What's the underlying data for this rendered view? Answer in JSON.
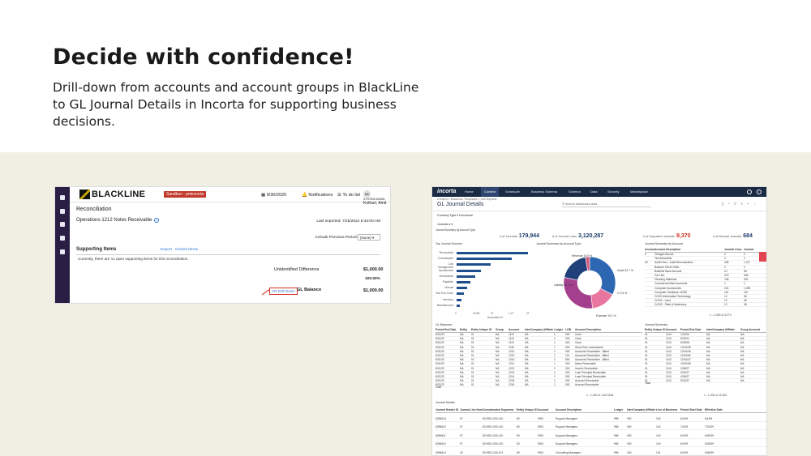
{
  "hero": {
    "title": "Decide with confidence!",
    "body": "Drill-down from accounts and account groups in BlackLine to GL Journal Details in Incorta for supporting business decisions."
  },
  "blackline": {
    "logo": "BLACKLINE",
    "sandbox": "Sandbox - pmincorta",
    "date": "9/30/2020",
    "notifications": "Notifications",
    "todo": "To do list",
    "avatar": "AK",
    "user_role": "SYSTEM ADMIN",
    "user_name": "Kothari, Amit",
    "page_title": "Reconciliation",
    "account": "Operations-1212 Notes Receivable",
    "last_imported": "Last imported: 7/25/2022 8:43:00 AM",
    "include_prev_label": "Include Previous Period:",
    "include_prev_value": "(None)",
    "supporting_items": "Supporting Items",
    "export": "Export",
    "closed_items": "Closed Items",
    "no_items": "Currently, there are no open supporting items for this reconciliation.",
    "unidentified_label": "Unidentified Difference",
    "unidentified_value": "$1,000.00",
    "percent_value": "100.00%",
    "drill_link": "AR Drill Down",
    "gl_label": "GL Balance",
    "gl_value": "$1,000.00",
    "accent": "#2a1e45"
  },
  "incorta": {
    "logo": "incorta",
    "nav": [
      "Home",
      "Content",
      "Scheduler",
      "Business Schema",
      "Schema",
      "Data",
      "Security",
      "Marketplace"
    ],
    "breadcrumb": "Content  >  BlackLine Templates  >  Drill Reports",
    "title": "GL Journal Details",
    "search_placeholder": "Search dashboard data",
    "currency_type": "Currency Type  ▾  Functional",
    "journals_label": "Journals  ▾  4",
    "kpis": [
      {
        "label": "# of Journals",
        "value": "179,944"
      },
      {
        "label": "# of Journal Lines",
        "value": "3,120,287"
      },
      {
        "label": "# of Unposted Journals",
        "value": "8,370"
      },
      {
        "label": "# of Manual Journals",
        "value": "684"
      }
    ],
    "sections": {
      "sources": "Top Journal Sources",
      "summary_type": "Journal Summary by Account Type",
      "summary_account": "Journal Summary by Account",
      "gl_balances": "GL Balances",
      "journal_summary": "Journal Summary",
      "journal_details": "Journal Details",
      "journal_summary_type_bar": "Journal Summary by Account Type",
      "x_axis": "Accounted Cr"
    },
    "chart_data": [
      {
        "type": "bar",
        "title": "Top Journal Sources",
        "categories": [
          "Receivables",
          "Consolidation",
          "Cost Management",
          "Spreadsheet",
          "Receivables",
          "Payables",
          "Manual",
          "Year End Close",
          "Inventory",
          "Miscellaneous"
        ],
        "values": [
          10.6,
          8.2,
          5.1,
          3.6,
          2.8,
          2.1,
          1.6,
          1.1,
          0.7,
          0.5
        ],
        "xlabel": "Accounted Cr",
        "x_ticks": [
          "0",
          "10.0B",
          "1T",
          "1.2T",
          "2T"
        ]
      },
      {
        "type": "pie",
        "title": "Journal Summary by Account Type",
        "labels": [
          "Asset 32.7 %",
          "Revenue 15.5 %",
          "Liability 30.1 %",
          "Expense 19.1 %",
          "O 2.6 %"
        ],
        "values": [
          32.7,
          15.5,
          30.1,
          19.1,
          2.6
        ],
        "colors": [
          "#2e67b1",
          "#e8769e",
          "#a43f8e",
          "#1f4079",
          "#d65a7d"
        ]
      }
    ],
    "account_table": {
      "headers": [
        "Account",
        "Account Description",
        "Journal Lines",
        "Journal"
      ],
      "rows": [
        [
          "0",
          "Charges Accrue",
          "2",
          "2"
        ],
        [
          "",
          "Tint deductible",
          "2",
          "2"
        ],
        [
          "00",
          "Audit Fees - Audit Remuneration",
          "296",
          "1,017"
        ],
        [
          "",
          "Balance Sheet Other",
          "2",
          "2"
        ],
        [
          "",
          "Backlink Bank Account",
          "12",
          "36"
        ],
        [
          "",
          "Car Hire",
          "379",
          "936"
        ],
        [
          "",
          "Cleaning Materials",
          "108",
          "324"
        ],
        [
          "",
          "Commercial Bank Accounts",
          "1",
          "1"
        ],
        [
          "",
          "Computer Accessories",
          "224",
          "1,005"
        ],
        [
          "",
          "Computer Hardware <£250",
          "110",
          "110"
        ],
        [
          "",
          "COGS Information Technology",
          "12",
          "36"
        ],
        [
          "",
          "COGS - Land",
          "12",
          "36"
        ],
        [
          "",
          "COGS - Plant & Machinery",
          "12",
          "36"
        ]
      ],
      "pager": "1 - 1,000 of 3,274"
    },
    "gl_table": {
      "headers": [
        "Period End Date",
        "Entity",
        "Entity Unique ID",
        "Group",
        "Account",
        "InterCompany Affiliate",
        "Ledger",
        "LOB",
        "Account Description"
      ],
      "rows": [
        [
          "8/31/22",
          "NA",
          "01",
          "NA",
          "1110",
          "NA",
          "1",
          "000",
          "Cash"
        ],
        [
          "8/31/22",
          "NA",
          "01",
          "NA",
          "1110",
          "NA",
          "1",
          "000",
          "Cash"
        ],
        [
          "8/31/22",
          "NA",
          "01",
          "NA",
          "1110",
          "NA",
          "1",
          "420",
          "Cash"
        ],
        [
          "8/31/22",
          "NA",
          "01",
          "NA",
          "1130",
          "NA",
          "1",
          "000",
          "Short Term Investments"
        ],
        [
          "8/31/22",
          "NA",
          "01",
          "NA",
          "1210",
          "NA",
          "1",
          "000",
          "Accounts Receivable - Billed"
        ],
        [
          "8/31/22",
          "NA",
          "01",
          "NA",
          "1210",
          "NA",
          "1",
          "110",
          "Accounts Receivable - Billed"
        ],
        [
          "8/31/22",
          "NA",
          "01",
          "NA",
          "1210",
          "NA",
          "1",
          "500",
          "Accounts Receivable - Billed"
        ],
        [
          "8/31/22",
          "NA",
          "01",
          "NA",
          "1211",
          "NA",
          "1",
          "000",
          "Notes Receivable"
        ],
        [
          "8/31/22",
          "NA",
          "01",
          "NA",
          "1212",
          "NA",
          "1",
          "000",
          "Invoice Receivable"
        ],
        [
          "8/31/22",
          "NA",
          "01",
          "NA",
          "1213",
          "NA",
          "1",
          "000",
          "Loan Principal Receivable"
        ],
        [
          "8/31/22",
          "NA",
          "01",
          "NA",
          "1214",
          "NA",
          "1",
          "000",
          "Loan Principal Receivable"
        ],
        [
          "8/31/22",
          "NA",
          "01",
          "NA",
          "1215",
          "NA",
          "1",
          "000",
          "Accrued Receivable"
        ],
        [
          "8/31/22",
          "NA",
          "01",
          "NA",
          "1216",
          "NA",
          "1",
          "000",
          "Accrued Receivable"
        ]
      ],
      "total": "Total",
      "pager": "1 - 1,000 of 1,647,818"
    },
    "summary_table": {
      "headers": [
        "Entity Unique ID",
        "Account",
        "Period End Date",
        "InterCompany Affiliate",
        "Group Account"
      ],
      "rows": [
        [
          "01",
          "1110",
          "1/31/04",
          "NA",
          "NA"
        ],
        [
          "01",
          "1110",
          "6/30/21",
          "NA",
          "NA"
        ],
        [
          "01",
          "1110",
          "6/30/06",
          "NA",
          "NA"
        ],
        [
          "01",
          "1110",
          "12/31/05",
          "NA",
          "NA"
        ],
        [
          "01",
          "1110",
          "12/31/06",
          "NA",
          "NA"
        ],
        [
          "01",
          "1110",
          "11/30/06",
          "NA",
          "NA"
        ],
        [
          "01",
          "1110",
          "12/31/07",
          "NA",
          "NA"
        ],
        [
          "01",
          "1110",
          "11/30/08",
          "NA",
          "NA"
        ],
        [
          "01",
          "1110",
          "2/28/07",
          "NA",
          "NA"
        ],
        [
          "01",
          "1110",
          "3/31/07",
          "NA",
          "NA"
        ],
        [
          "01",
          "1110",
          "4/30/07",
          "NA",
          "NA"
        ],
        [
          "01",
          "1110",
          "5/31/07",
          "NA",
          "NA"
        ]
      ],
      "total": "Total",
      "pager": "1 - 1,000 of 11,062"
    },
    "details_table": {
      "headers": [
        "Journal Header ID",
        "Journal Line Num",
        "Concatenated Segments",
        "Entity Unique ID",
        "Account",
        "Account Description",
        "Ledger",
        "InterCompany Affiliate",
        "Line of Business",
        "Period Start Date",
        "Effective Date"
      ],
      "rows": [
        [
          "6256613",
          "57",
          "83-9921-000-140",
          "80",
          "9921",
          "Support Managers",
          "956",
          "000",
          "140",
          "6/1/09",
          "6/1/09"
        ],
        [
          "6256612",
          "57",
          "83-9921-000-140",
          "80",
          "9921",
          "Support Managers",
          "956",
          "000",
          "140",
          "7/1/09",
          "7/31/09"
        ],
        [
          "6256611",
          "57",
          "83-9921-000-140",
          "83",
          "9921",
          "Support Managers",
          "956",
          "000",
          "140",
          "6/1/09",
          "6/30/09"
        ],
        [
          "6256610",
          "57",
          "83-9921-000-140",
          "83",
          "9921",
          "Support Managers",
          "956",
          "000",
          "140",
          "6/1/09",
          "6/30/09"
        ],
        [
          "6256614",
          "43",
          "83-9921-240-101",
          "80",
          "9921",
          "Consulting Managers",
          "956",
          "240",
          "101",
          "6/1/09",
          "6/30/09"
        ]
      ]
    }
  }
}
